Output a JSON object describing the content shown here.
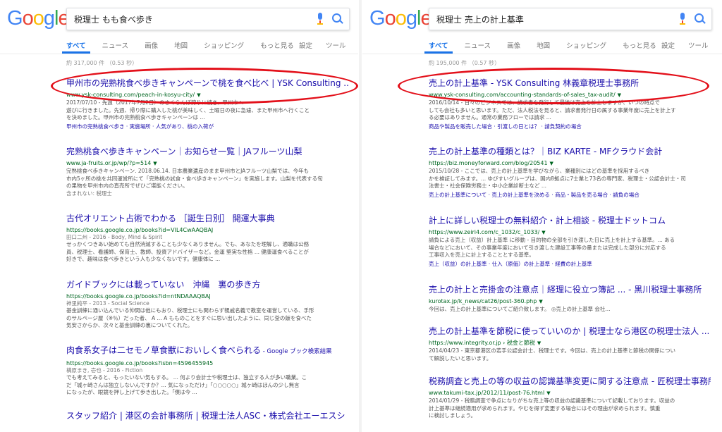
{
  "brand_colors": {
    "blue": "#4285f4",
    "red": "#ea4335",
    "yellow": "#fbbc05",
    "green": "#34a853",
    "link": "#1a0dab",
    "url": "#006621",
    "highlight": "#e3101a"
  },
  "logo_letters": [
    "G",
    "o",
    "o",
    "g",
    "l",
    "e"
  ],
  "left": {
    "query": "税理士 もも食べ歩き",
    "tabs": [
      "すべて",
      "ニュース",
      "画像",
      "地図",
      "ショッピング",
      "もっと見る"
    ],
    "tools": [
      "設定",
      "ツール"
    ],
    "stats": "約 317,000 件 （0.53 秒）",
    "results": [
      {
        "title": "甲州市の完熟桃食べ歩きキャンペーンで桃を食べ比べ | YSK Consulting ...",
        "url": "www.ysk-consulting.com/peach-in-kosyu-city/",
        "snippet": [
          "2017/07/10 - 先週（2017年7月2日）のさくらんぼ狩りに続き、甲州市へ",
          "遊びに行きました。先週、帰り際に購入した桃が美味しく、土曜日の夜に急遽、また甲州市へ行くこと",
          "を決めました。甲州市の完熟桃食べ歩きキャンペーンは ..."
        ],
        "links": "甲州市の完熟桃食べ歩き · 実施場所 · 人気があり、桃の入荷が"
      },
      {
        "title": "完熟桃食べ歩きキャンペーン｜お知らせ一覧｜JAフルーツ山梨",
        "url": "www.ja-fruits.or.jp/wp/?p=514",
        "snippet": [
          "完熟桃食べ歩きキャンペーン. 2018.06.14. 日本農業遺産のまま甲州市とJAフルーツ山梨では、今年も",
          "市内5ヶ所の桃を共同運営所にて「完熟桃の試食・食べ歩きキャンペーン」を実施します。山梨を代表する旬",
          "の果物を甲州市内の直売所でぜひご堪能ください。"
        ],
        "extra": "含まれない: 税理士"
      },
      {
        "title": "古代オリエント占術でわかる ［誕生日別］ 開運大事典",
        "url": "https://books.google.co.jp/books?id=VIL4CwAAQBAJ",
        "meta": "田口二州 - 2016 - Body, Mind & Spirit",
        "snippet": [
          "せっかくつきあい始めても自然消滅することも少なくありません。でも、あなたを理解し、適職は公務",
          "員、税理士、看護師、保育士、教師、投資アドバイザーなど。金運 堅実な性格 ... 健康運食べることが",
          "好きで、趣味は食べ歩きという人も少なくないです。健康体に ..."
        ]
      },
      {
        "title": "ガイドブックには載っていない　沖縄　裏の歩き方",
        "url": "https://books.google.co.jp/books?id=ntNDAAAQBAJ",
        "meta": "神里純平 - 2013 - Social Science",
        "snippet": [
          "基金訓練に通い込んでいる仲間は他にもおり、税理士にも関わらず親戚名義で教室を運営している、手形",
          "のサルページ屋（※％）だった者、 A ... A もものことをすぐに思い出したように、同じ釜の飯を食べた",
          "気安さからか、次々と基金訓練の裏についてくれた。"
        ]
      },
      {
        "title": "肉食系女子は二セモノ草食獣においしく食べられる",
        "title_suffix": " - Google ブック検索結果",
        "url": "https://books.google.co.jp/books?isbn=4596455945",
        "meta": "構原まき, 壱也 - 2016 - Fiction",
        "snippet": [
          "でも考えてみると、もったいない気もする。 ... 何より会計士や税理士は、独立する人が多い職業。こ",
          "だ「城ヶ崎さんは独立しないんですか？... 気になっただけ」「○○○○○」城ヶ崎はほんの少し無言",
          "になったが、眼鏡を押し上げて歩き出した。「僕は今 ..."
        ]
      },
      {
        "title": "スタッフ紹介 | 港区の会計事務所 | 税理士法人ASC・株式会社エーエスシ",
        "url": "",
        "snippet": []
      }
    ]
  },
  "right": {
    "query": "税理士 売上の計上基準",
    "tabs": [
      "すべて",
      "ニュース",
      "画像",
      "地図",
      "ショッピング",
      "もっと見る"
    ],
    "tools": [
      "設定",
      "ツール"
    ],
    "stats": "約 195,000 件 （0.57 秒）",
    "results": [
      {
        "title": "売上の計上基準 - YSK Consulting 林義章税理士事務所",
        "url": "www.ysk-consulting.com/accounting-standards-of-sales_tax-audit/",
        "snippet": [
          "2016/10/14 - 日々のビジネスでは、請求書を発行して最後は売上を計上しますが、いつの時点で",
          "しても会社も多いと思います。ただ、法人税法を見ると、請求書発行日の属する事業年度に売上を計上す",
          "る必要はありません。通常の業務フローでは請求 ..."
        ],
        "links": "商品や製品を販売した場合 · 引渡しの日とは？ · 請負契約の場合"
      },
      {
        "title": "売上の計上基準の種類とは？｜BIZ KARTE - MFクラウド会計",
        "url": "https://biz.moneyforward.com/blog/20541",
        "snippet": [
          "2015/10/28 - ここでは、売上の計上基準を学びながら、業種別にはどの基準を採用するべき",
          "かを検証してみます。... ゆびすいグループは、国内8拠点に7士業と73名の専門家、税理士・公認会計士・司",
          "法書士・社会保険労務士・中小企業診断士など ..."
        ],
        "links": "売上の計上基準について · 売上の計上基準を決める · 商品・製品を売る場合 · 請負の場合"
      },
      {
        "title": "計上に詳しい税理士の無料紹介・計上相談 - 税理士ドットコム",
        "url": "https://www.zeiri4.com/c_1032/c_1033/",
        "snippet": [
          "請負による売上（収益）計上基準 に移動 - 目的物の全部を引き渡した日に売上を計上する基準。... ある",
          "場合などにおいて、その事業年度において引き渡した建設工事等の量または完成した部分に対応する",
          "工事収入を売上に計上することとする基準。"
        ],
        "links": "売上（収益）の計上基準 · 仕入（原価）の計上基準 · 経費の計上基準"
      },
      {
        "title": "売上の計上と売掛金の注意点｜経理に役立つ簿記 ... - 黒川税理士事務所",
        "url": "kurotax.jp/k_news/cat26/post-360.php",
        "snippet": [
          "今回は、売上の計上基準についてご紹介致します。 ◎売上の計上基準 会社..."
        ]
      },
      {
        "title": "売上の計上基準を節税に使っていいのか | 税理士なら港区の税理士法人 ...",
        "url": "https://www.integrity.or.jp › 税金と節税",
        "snippet": [
          "2014/04/23 - 東京都港区の若手公認会計士、税理士です。今回は、売上の計上基準と節税の関係につい",
          "て解説したいと思います。"
        ]
      },
      {
        "title": "税務調査と売上の等の収益の認識基準変更に関する注意点 - 匠税理士事務所",
        "url": "www.takumi-tax.jp/2012/11/post-76.html",
        "snippet": [
          "2014/01/29 - 税務調査で争点になりがちな売上等の収益の認識基準について記載しております。収益の",
          "計上基準は継続適用が求められます。やむを得ず変更する場合にはその理由が求められます。慎重",
          "に検討しましょう。"
        ]
      }
    ]
  }
}
